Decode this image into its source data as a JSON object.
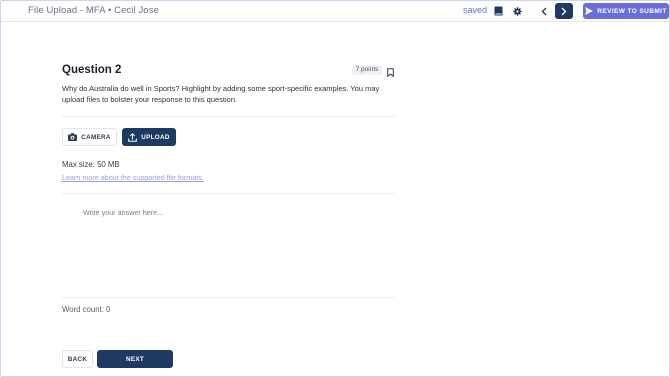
{
  "header": {
    "title": "File Upload - MFA • Cecil Jose",
    "saved_label": "saved",
    "review_label": "REVIEW TO SUBMIT",
    "icons": [
      "book-icon",
      "gear-icon",
      "chevron-left-icon",
      "chevron-right-icon",
      "send-icon"
    ]
  },
  "question": {
    "title": "Question 2",
    "points": "7 points",
    "text": "Why do Australia do well in Sports? Highlight by adding some sport-specific examples. You may upload files to bolster your response to this question."
  },
  "upload": {
    "camera_label": "CAMERA",
    "upload_label": "UPLOAD",
    "max_size": "Max size: 50 MB",
    "formats_link": "Learn more about the supported file formats."
  },
  "answer": {
    "placeholder": "Write your answer here...",
    "word_count": "Word count: 0"
  },
  "footer": {
    "back_label": "BACK",
    "next_label": "NEXT"
  },
  "colors": {
    "primary": "#1e3a63",
    "accent": "#6a6edb",
    "link": "#9a9ede"
  }
}
